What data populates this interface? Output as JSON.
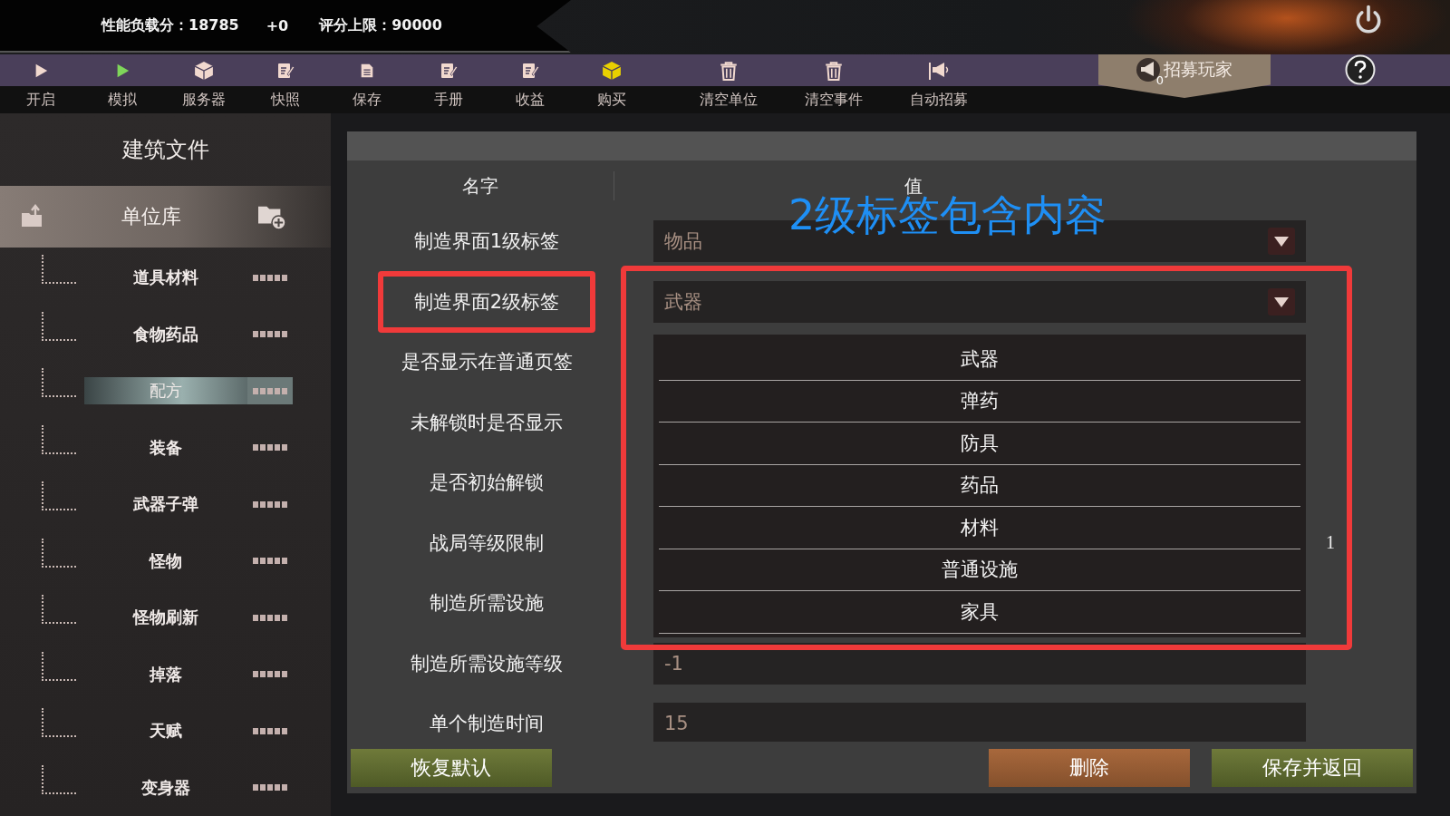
{
  "top_bar": {
    "score": "性能负载分：18785",
    "delta": "+0",
    "limit": "评分上限：90000"
  },
  "toolbar": {
    "items": [
      {
        "label": "开启",
        "kind": "play",
        "color": "#f1d9cf"
      },
      {
        "label": "模拟",
        "kind": "play",
        "color": "#7fd65a"
      },
      {
        "label": "服务器",
        "kind": "cube",
        "color": "#f1d9cf"
      },
      {
        "label": "快照",
        "kind": "note",
        "color": "#f1d9cf"
      },
      {
        "label": "保存",
        "kind": "disk",
        "color": "#f1d9cf"
      },
      {
        "label": "手册",
        "kind": "note",
        "color": "#f1d9cf"
      },
      {
        "label": "收益",
        "kind": "note",
        "color": "#f1d9cf"
      },
      {
        "label": "购买",
        "kind": "cube",
        "color": "#e8d000"
      },
      {
        "label": "清空单位",
        "kind": "trash",
        "color": "#f1d9cf"
      },
      {
        "label": "清空事件",
        "kind": "trash",
        "color": "#f1d9cf"
      },
      {
        "label": "自动招募",
        "kind": "flag",
        "color": "#f1d9cf"
      }
    ],
    "recruit": {
      "label": "招募玩家",
      "badge": "0"
    }
  },
  "sidebar": {
    "title": "建筑文件",
    "library": "单位库",
    "items": [
      {
        "label": "道具材料",
        "selected": false
      },
      {
        "label": "食物药品",
        "selected": false
      },
      {
        "label": "配方",
        "selected": true
      },
      {
        "label": "装备",
        "selected": false
      },
      {
        "label": "武器子弹",
        "selected": false
      },
      {
        "label": "怪物",
        "selected": false
      },
      {
        "label": "怪物刷新",
        "selected": false
      },
      {
        "label": "掉落",
        "selected": false
      },
      {
        "label": "天赋",
        "selected": false
      },
      {
        "label": "变身器",
        "selected": false
      }
    ]
  },
  "panel": {
    "columns": [
      "名字",
      "值"
    ],
    "rows": [
      {
        "name": "制造界面1级标签",
        "kind": "dropdown",
        "value": "物品",
        "highlighted": false
      },
      {
        "name": "制造界面2级标签",
        "kind": "dropdown",
        "value": "武器",
        "highlighted": true
      },
      {
        "name": "是否显示在普通页签",
        "kind": "covered",
        "highlighted": false
      },
      {
        "name": "未解锁时是否显示",
        "kind": "covered",
        "highlighted": false
      },
      {
        "name": "是否初始解锁",
        "kind": "covered",
        "highlighted": false
      },
      {
        "name": "战局等级限制",
        "kind": "covered",
        "reading": "1",
        "highlighted": false
      },
      {
        "name": "制造所需设施",
        "kind": "covered",
        "highlighted": false
      },
      {
        "name": "制造所需设施等级",
        "kind": "field",
        "value": "-1",
        "highlighted": false
      },
      {
        "name": "单个制造时间",
        "kind": "field",
        "value": "15",
        "highlighted": false
      }
    ],
    "dropdown_list": {
      "outlined": true,
      "options": [
        "武器",
        "弹药",
        "防具",
        "药品",
        "材料",
        "普通设施",
        "家具"
      ]
    },
    "callout": "2级标签包含内容",
    "buttons": [
      {
        "label": "恢复默认",
        "kind": "green"
      },
      {
        "label": "删除",
        "kind": "orange"
      },
      {
        "label": "保存并返回",
        "kind": "green"
      }
    ]
  }
}
